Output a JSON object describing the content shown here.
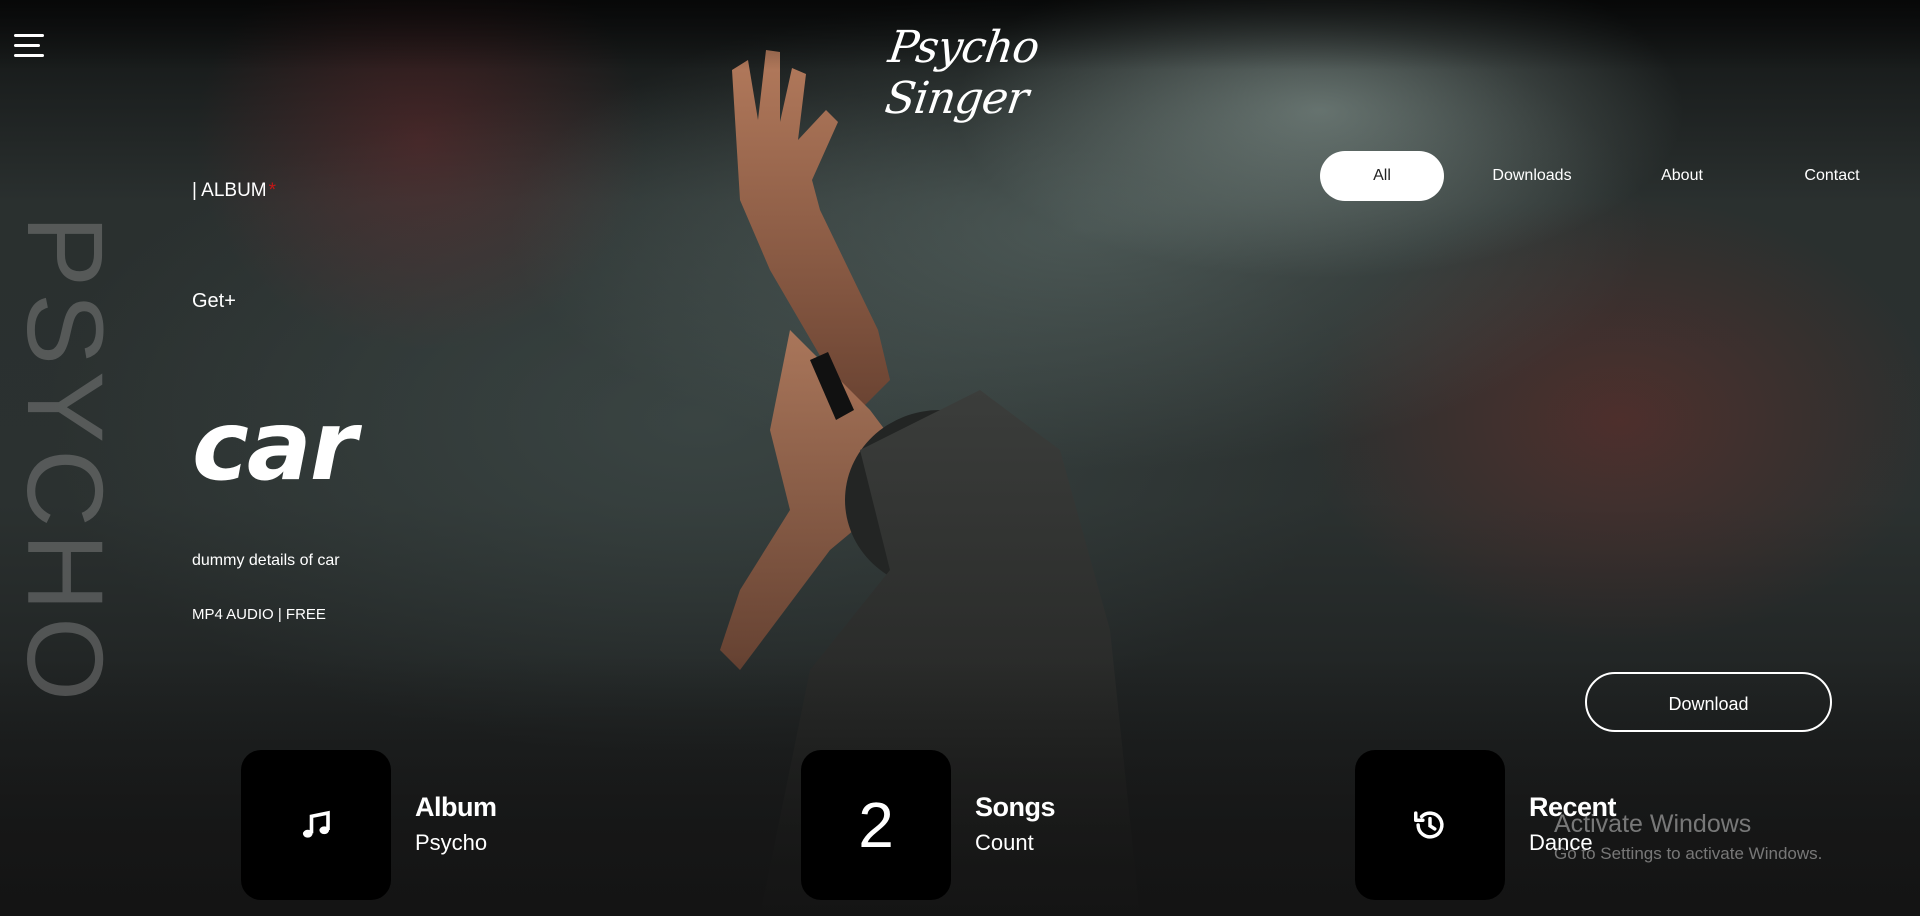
{
  "header": {
    "logo_text": "Psycho Singer",
    "menu_icon": "hamburger-menu-icon"
  },
  "background": {
    "vertical_word": "PSYCHO"
  },
  "nav": {
    "items": [
      {
        "label": "All",
        "active": true
      },
      {
        "label": "Downloads",
        "active": false
      },
      {
        "label": "About",
        "active": false
      },
      {
        "label": "Contact",
        "active": false
      }
    ]
  },
  "hero": {
    "album_tag": "| ALBUM",
    "album_tag_star": "*",
    "getplus": "Get+",
    "title": "car",
    "description": "dummy details of car",
    "meta": "MP4 AUDIO | FREE",
    "download_label": "Download"
  },
  "stats": [
    {
      "icon": "music-note-icon",
      "value": "",
      "label": "Album",
      "sub": "Psycho"
    },
    {
      "icon": "",
      "value": "2",
      "label": "Songs",
      "sub": "Count"
    },
    {
      "icon": "history-icon",
      "value": "",
      "label": "Recent",
      "sub": "Dance"
    }
  ],
  "windows_watermark": {
    "title": "Activate Windows",
    "subtitle": "Go to Settings to activate Windows."
  },
  "colors": {
    "accent_star": "#c41616",
    "card_bg": "#000000",
    "active_nav_bg": "#ffffff"
  }
}
